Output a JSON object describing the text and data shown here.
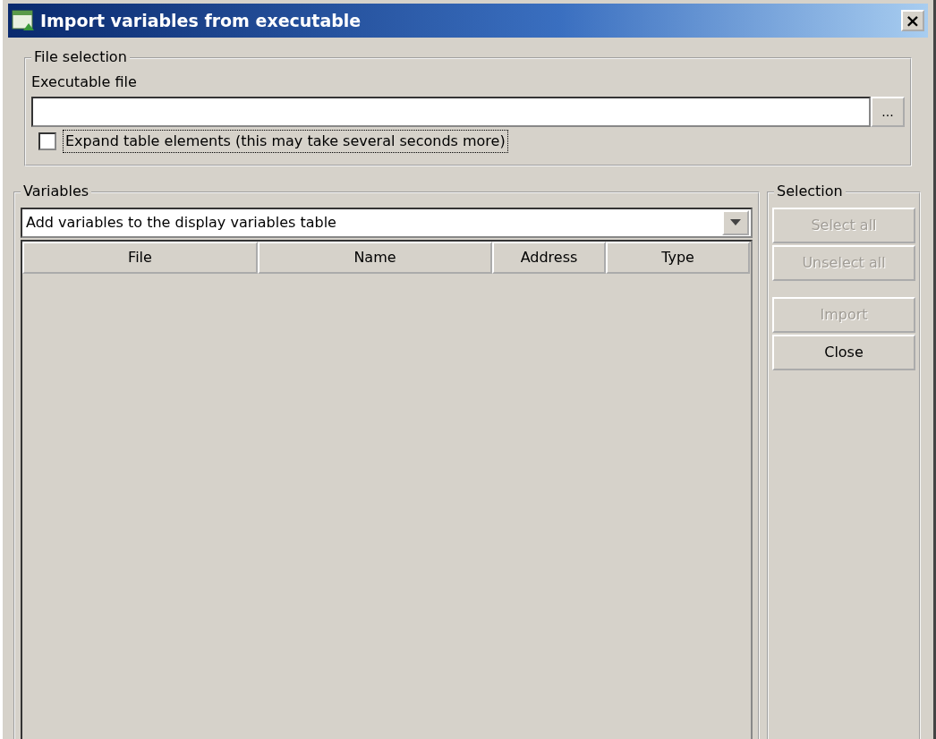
{
  "window": {
    "title": "Import variables from executable",
    "close_label": "×"
  },
  "file_selection": {
    "legend": "File selection",
    "label": "Executable file",
    "browse_label": "...",
    "expand_checkbox": {
      "label": "Expand table elements (this may take several seconds more)",
      "checked": false,
      "focused": true
    }
  },
  "variables": {
    "legend": "Variables",
    "mode": "Add variables to the display variables table",
    "table": {
      "columns": [
        {
          "label": "File"
        },
        {
          "label": "Name"
        },
        {
          "label": "Address"
        },
        {
          "label": "Type"
        }
      ]
    }
  },
  "selection": {
    "legend": "Selection",
    "buttons": [
      {
        "label": "Select all",
        "disabled": true
      },
      {
        "label": "Unselect all",
        "disabled": true
      },
      {
        "label": "Import",
        "disabled": true
      },
      {
        "label": "Close",
        "disabled": false
      }
    ]
  }
}
